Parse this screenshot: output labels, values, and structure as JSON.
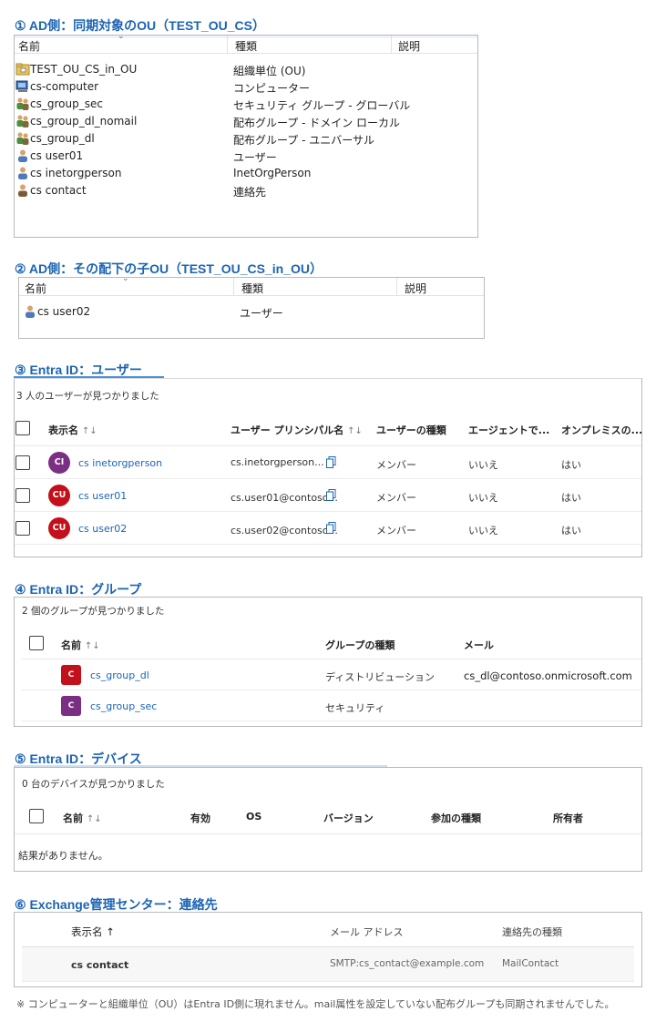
{
  "sec1": {
    "title": "① AD側：同期対象のOU（TEST_OU_CS）",
    "headers": [
      "名前",
      "種類",
      "説明"
    ],
    "rows": [
      {
        "name": "TEST_OU_CS_in_OU",
        "type": "組織単位 (OU)",
        "icon": "folder-icon"
      },
      {
        "name": "cs-computer",
        "type": "コンピューター",
        "icon": "computer-icon"
      },
      {
        "name": "cs_group_sec",
        "type": "セキュリティ グループ - グローバル",
        "icon": "group-icon"
      },
      {
        "name": "cs_group_dl_nomail",
        "type": "配布グループ - ドメイン ローカル",
        "icon": "group-icon"
      },
      {
        "name": "cs_group_dl",
        "type": "配布グループ - ユニバーサル",
        "icon": "group-icon"
      },
      {
        "name": "cs user01",
        "type": "ユーザー",
        "icon": "user-icon"
      },
      {
        "name": "cs inetorgperson",
        "type": "InetOrgPerson",
        "icon": "user-icon"
      },
      {
        "name": "cs contact",
        "type": "連絡先",
        "icon": "contact-icon"
      }
    ]
  },
  "sec2": {
    "title": "② AD側：その配下の子OU（TEST_OU_CS_in_OU）",
    "headers": [
      "名前",
      "種類",
      "説明"
    ],
    "rows": [
      {
        "name": "cs user02",
        "type": "ユーザー",
        "icon": "user-icon"
      }
    ]
  },
  "sec3": {
    "title": "③ Entra ID：ユーザー",
    "found": "3 人のユーザーが見つかりました",
    "headers": [
      "表示名",
      "ユーザー プリンシパル名",
      "ユーザーの種類",
      "エージェントで...",
      "オンプレミスの..."
    ],
    "sort_glyph": "↑↓",
    "rows": [
      {
        "initials": "CI",
        "color": "#7b2f82",
        "name": "cs inetorgperson",
        "upn": "cs.inetorgperson...",
        "type": "メンバー",
        "agent": "いいえ",
        "onprem": "はい"
      },
      {
        "initials": "CU",
        "color": "#c3101a",
        "name": "cs user01",
        "upn": "cs.user01@contoso...",
        "type": "メンバー",
        "agent": "いいえ",
        "onprem": "はい"
      },
      {
        "initials": "CU",
        "color": "#c3101a",
        "name": "cs user02",
        "upn": "cs.user02@contoso...",
        "type": "メンバー",
        "agent": "いいえ",
        "onprem": "はい"
      }
    ]
  },
  "sec4": {
    "title": "④ Entra ID：グループ",
    "found": "2 個のグループが見つかりました",
    "headers": [
      "名前",
      "グループの種類",
      "メール"
    ],
    "rows": [
      {
        "initial": "C",
        "color": "#c3101a",
        "name": "cs_group_dl",
        "type": "ディストリビューション",
        "mail": "cs_dl@contoso.onmicrosoft.com"
      },
      {
        "initial": "C",
        "color": "#7b2f82",
        "name": "cs_group_sec",
        "type": "セキュリティ",
        "mail": ""
      }
    ]
  },
  "sec5": {
    "title": "⑤ Entra ID：デバイス",
    "found": "0 台のデバイスが見つかりました",
    "headers": [
      "名前",
      "有効",
      "OS",
      "バージョン",
      "参加の種類",
      "所有者"
    ],
    "empty": "結果がありません。"
  },
  "sec6": {
    "title": "⑥ Exchange管理センター：連絡先",
    "headers": [
      "表示名 ↑",
      "メール アドレス",
      "連絡先の種類"
    ],
    "row": {
      "name": "cs contact",
      "mail": "SMTP:cs_contact@example.com",
      "type": "MailContact"
    }
  },
  "footnote": "※ コンピューターと組織単位（OU）はEntra ID側に現れません。mail属性を設定していない配布グループも同期されませんでした。",
  "colors": {
    "title": "#1c64b4",
    "link": "#1c64b4",
    "accent_line": "#4a90d6"
  }
}
